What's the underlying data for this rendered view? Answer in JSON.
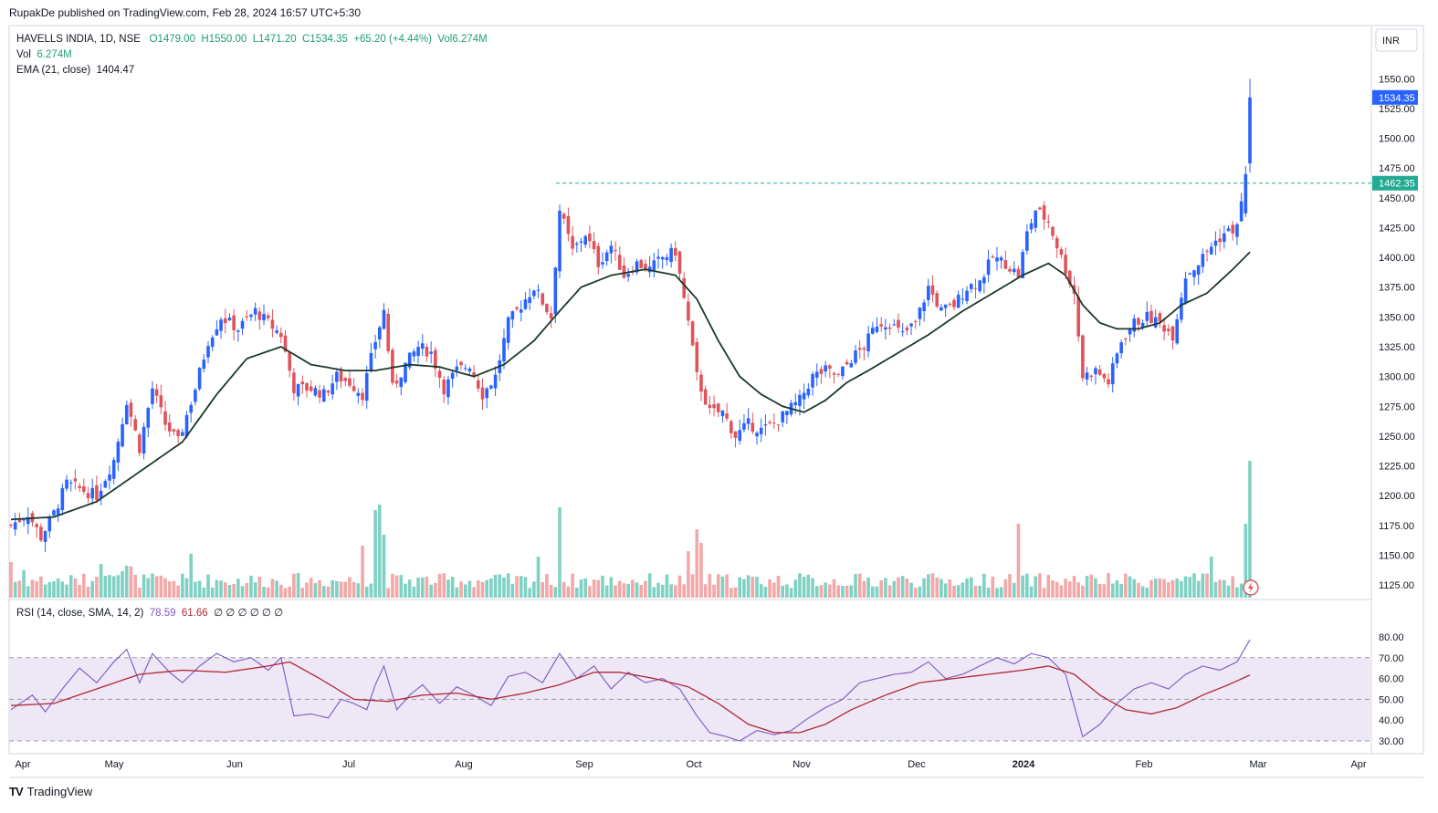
{
  "publisher_line": "RupakDe published on TradingView.com, Feb 28, 2024 16:57 UTC+5:30",
  "legend": {
    "symbol": "HAVELLS INDIA, 1D, NSE",
    "open": "O1479.00",
    "high": "H1550.00",
    "low": "L1471.20",
    "close": "C1534.35",
    "change": "+65.20 (+4.44%)",
    "volume": "Vol6.274M",
    "vol_label": "Vol",
    "vol_value": "6.274M",
    "ema_label": "EMA (21, close)",
    "ema_value": "1404.47"
  },
  "rsi_legend": {
    "label": "RSI (14, close, SMA, 14, 2)",
    "rsi_value": "78.59",
    "sma_value": "61.66",
    "zeros": "∅ ∅ ∅ ∅ ∅ ∅"
  },
  "currency_button": "INR",
  "brand": "TradingView",
  "colors": {
    "up": "#2962ff",
    "down": "#e0535b",
    "vol_up": "#7fd1c3",
    "vol_down": "#f2a8a8",
    "ema": "#1b3a2b",
    "rsi": "#7e57c2",
    "rsi_sma": "#b22833",
    "rsi_band": "#ede7f6",
    "last_price_badge": "#2962ff",
    "level_badge": "#22ab94"
  },
  "chart_data": {
    "type": "candlestick",
    "symbol": "HAVELLS INDIA",
    "interval": "1D",
    "exchange": "NSE",
    "price_axis": {
      "ticks": [
        1125,
        1150,
        1175,
        1200,
        1225,
        1250,
        1275,
        1300,
        1325,
        1350,
        1375,
        1400,
        1425,
        1450,
        1475,
        1500,
        1525,
        1550
      ],
      "range": [
        1110,
        1570
      ],
      "last_price_label": "1534.35",
      "level_label": "1462.35"
    },
    "horizontal_level": 1462.35,
    "last_price": 1534.35,
    "time_axis": [
      "Apr",
      "May",
      "Jun",
      "Jul",
      "Aug",
      "Sep",
      "Oct",
      "Nov",
      "Dec",
      "2024",
      "Feb",
      "Mar",
      "Apr"
    ],
    "close_path": [
      [
        0,
        1175
      ],
      [
        4,
        1185
      ],
      [
        7,
        1165
      ],
      [
        10,
        1185
      ],
      [
        13,
        1210
      ],
      [
        20,
        1200
      ],
      [
        24,
        1230
      ],
      [
        27,
        1280
      ],
      [
        30,
        1240
      ],
      [
        33,
        1290
      ],
      [
        36,
        1260
      ],
      [
        39,
        1245
      ],
      [
        43,
        1290
      ],
      [
        46,
        1330
      ],
      [
        49,
        1350
      ],
      [
        53,
        1340
      ],
      [
        57,
        1355
      ],
      [
        60,
        1345
      ],
      [
        63,
        1335
      ],
      [
        66,
        1290
      ],
      [
        70,
        1290
      ],
      [
        73,
        1285
      ],
      [
        76,
        1300
      ],
      [
        79,
        1295
      ],
      [
        82,
        1285
      ],
      [
        85,
        1330
      ],
      [
        87,
        1355
      ],
      [
        89,
        1290
      ],
      [
        92,
        1310
      ],
      [
        95,
        1325
      ],
      [
        98,
        1320
      ],
      [
        101,
        1290
      ],
      [
        104,
        1305
      ],
      [
        107,
        1310
      ],
      [
        110,
        1285
      ],
      [
        113,
        1300
      ],
      [
        116,
        1345
      ],
      [
        119,
        1360
      ],
      [
        122,
        1375
      ],
      [
        126,
        1350
      ],
      [
        128,
        1440
      ],
      [
        131,
        1405
      ],
      [
        134,
        1420
      ],
      [
        137,
        1395
      ],
      [
        140,
        1410
      ],
      [
        143,
        1385
      ],
      [
        146,
        1395
      ],
      [
        149,
        1390
      ],
      [
        152,
        1400
      ],
      [
        155,
        1405
      ],
      [
        158,
        1345
      ],
      [
        160,
        1300
      ],
      [
        163,
        1270
      ],
      [
        166,
        1270
      ],
      [
        169,
        1250
      ],
      [
        172,
        1260
      ],
      [
        175,
        1255
      ],
      [
        178,
        1260
      ],
      [
        181,
        1270
      ],
      [
        184,
        1280
      ],
      [
        187,
        1300
      ],
      [
        190,
        1305
      ],
      [
        193,
        1300
      ],
      [
        196,
        1315
      ],
      [
        199,
        1325
      ],
      [
        202,
        1345
      ],
      [
        205,
        1345
      ],
      [
        208,
        1335
      ],
      [
        211,
        1345
      ],
      [
        214,
        1375
      ],
      [
        217,
        1355
      ],
      [
        220,
        1360
      ],
      [
        223,
        1375
      ],
      [
        226,
        1380
      ],
      [
        229,
        1400
      ],
      [
        232,
        1395
      ],
      [
        235,
        1385
      ],
      [
        237,
        1420
      ],
      [
        239,
        1440
      ],
      [
        242,
        1430
      ],
      [
        245,
        1400
      ],
      [
        248,
        1370
      ],
      [
        250,
        1300
      ],
      [
        253,
        1305
      ],
      [
        256,
        1295
      ],
      [
        259,
        1330
      ],
      [
        262,
        1345
      ],
      [
        265,
        1350
      ],
      [
        268,
        1345
      ],
      [
        271,
        1335
      ],
      [
        274,
        1385
      ],
      [
        277,
        1395
      ],
      [
        280,
        1410
      ],
      [
        283,
        1420
      ],
      [
        286,
        1425
      ],
      [
        288,
        1470
      ],
      [
        289,
        1534.35
      ]
    ],
    "ema21_path": [
      [
        0,
        1180
      ],
      [
        10,
        1182
      ],
      [
        20,
        1195
      ],
      [
        30,
        1220
      ],
      [
        40,
        1245
      ],
      [
        48,
        1285
      ],
      [
        55,
        1315
      ],
      [
        63,
        1325
      ],
      [
        70,
        1310
      ],
      [
        78,
        1305
      ],
      [
        85,
        1305
      ],
      [
        93,
        1310
      ],
      [
        100,
        1308
      ],
      [
        108,
        1300
      ],
      [
        115,
        1310
      ],
      [
        122,
        1330
      ],
      [
        128,
        1355
      ],
      [
        133,
        1375
      ],
      [
        140,
        1385
      ],
      [
        148,
        1390
      ],
      [
        155,
        1385
      ],
      [
        160,
        1365
      ],
      [
        165,
        1330
      ],
      [
        170,
        1300
      ],
      [
        175,
        1285
      ],
      [
        180,
        1275
      ],
      [
        185,
        1270
      ],
      [
        190,
        1280
      ],
      [
        195,
        1295
      ],
      [
        200,
        1305
      ],
      [
        207,
        1320
      ],
      [
        214,
        1335
      ],
      [
        222,
        1355
      ],
      [
        229,
        1370
      ],
      [
        236,
        1385
      ],
      [
        242,
        1395
      ],
      [
        246,
        1385
      ],
      [
        250,
        1360
      ],
      [
        254,
        1345
      ],
      [
        258,
        1340
      ],
      [
        263,
        1340
      ],
      [
        268,
        1345
      ],
      [
        273,
        1360
      ],
      [
        279,
        1370
      ],
      [
        285,
        1390
      ],
      [
        289,
        1404.47
      ]
    ],
    "rsi_panel": {
      "ticks": [
        30,
        40,
        50,
        60,
        70,
        80
      ],
      "range": [
        28,
        82
      ],
      "band": [
        30,
        70
      ],
      "rsi_path": [
        [
          0,
          45
        ],
        [
          5,
          52
        ],
        [
          8,
          44
        ],
        [
          12,
          55
        ],
        [
          16,
          65
        ],
        [
          20,
          58
        ],
        [
          24,
          68
        ],
        [
          27,
          74
        ],
        [
          30,
          58
        ],
        [
          33,
          72
        ],
        [
          37,
          63
        ],
        [
          40,
          58
        ],
        [
          44,
          66
        ],
        [
          48,
          72
        ],
        [
          52,
          68
        ],
        [
          56,
          70
        ],
        [
          60,
          64
        ],
        [
          63,
          70
        ],
        [
          66,
          42
        ],
        [
          70,
          43
        ],
        [
          74,
          41
        ],
        [
          77,
          50
        ],
        [
          80,
          48
        ],
        [
          83,
          45
        ],
        [
          85,
          57
        ],
        [
          87,
          66
        ],
        [
          90,
          45
        ],
        [
          93,
          52
        ],
        [
          96,
          57
        ],
        [
          100,
          48
        ],
        [
          104,
          56
        ],
        [
          108,
          52
        ],
        [
          112,
          47
        ],
        [
          116,
          61
        ],
        [
          120,
          63
        ],
        [
          124,
          58
        ],
        [
          128,
          72
        ],
        [
          132,
          60
        ],
        [
          136,
          66
        ],
        [
          140,
          55
        ],
        [
          144,
          63
        ],
        [
          148,
          58
        ],
        [
          152,
          60
        ],
        [
          156,
          55
        ],
        [
          160,
          42
        ],
        [
          163,
          34
        ],
        [
          167,
          32
        ],
        [
          170,
          30
        ],
        [
          174,
          35
        ],
        [
          178,
          33
        ],
        [
          182,
          35
        ],
        [
          186,
          41
        ],
        [
          190,
          46
        ],
        [
          194,
          50
        ],
        [
          198,
          58
        ],
        [
          202,
          60
        ],
        [
          206,
          62
        ],
        [
          210,
          63
        ],
        [
          214,
          68
        ],
        [
          218,
          60
        ],
        [
          222,
          62
        ],
        [
          226,
          66
        ],
        [
          230,
          70
        ],
        [
          234,
          67
        ],
        [
          238,
          72
        ],
        [
          242,
          70
        ],
        [
          246,
          62
        ],
        [
          250,
          32
        ],
        [
          254,
          38
        ],
        [
          258,
          48
        ],
        [
          262,
          55
        ],
        [
          266,
          58
        ],
        [
          270,
          55
        ],
        [
          274,
          62
        ],
        [
          278,
          66
        ],
        [
          282,
          64
        ],
        [
          286,
          68
        ],
        [
          289,
          78.59
        ]
      ],
      "sma_path": [
        [
          0,
          47
        ],
        [
          10,
          48
        ],
        [
          20,
          55
        ],
        [
          30,
          62
        ],
        [
          40,
          64
        ],
        [
          50,
          63
        ],
        [
          60,
          66
        ],
        [
          65,
          68
        ],
        [
          72,
          60
        ],
        [
          80,
          50
        ],
        [
          88,
          49
        ],
        [
          96,
          52
        ],
        [
          104,
          53
        ],
        [
          112,
          50
        ],
        [
          120,
          53
        ],
        [
          128,
          57
        ],
        [
          136,
          63
        ],
        [
          142,
          63
        ],
        [
          150,
          60
        ],
        [
          158,
          56
        ],
        [
          165,
          48
        ],
        [
          172,
          38
        ],
        [
          178,
          34
        ],
        [
          184,
          34
        ],
        [
          190,
          38
        ],
        [
          196,
          45
        ],
        [
          204,
          52
        ],
        [
          212,
          58
        ],
        [
          220,
          60
        ],
        [
          228,
          62
        ],
        [
          236,
          64
        ],
        [
          242,
          66
        ],
        [
          248,
          62
        ],
        [
          254,
          52
        ],
        [
          260,
          45
        ],
        [
          266,
          43
        ],
        [
          272,
          46
        ],
        [
          278,
          52
        ],
        [
          284,
          57
        ],
        [
          289,
          61.66
        ]
      ]
    }
  }
}
